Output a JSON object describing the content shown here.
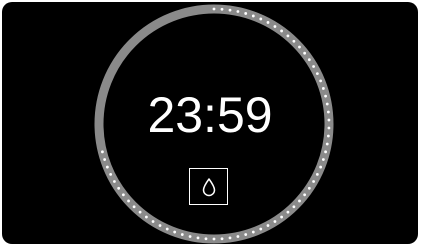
{
  "display": {
    "time": "23:59",
    "progress_fraction": 0.72
  },
  "controls": {
    "mode_icon": "water-drop-icon"
  },
  "colors": {
    "background": "#000000",
    "ring_track": "#8a8a8a",
    "ring_dots": "#ffffff",
    "text": "#ffffff"
  }
}
